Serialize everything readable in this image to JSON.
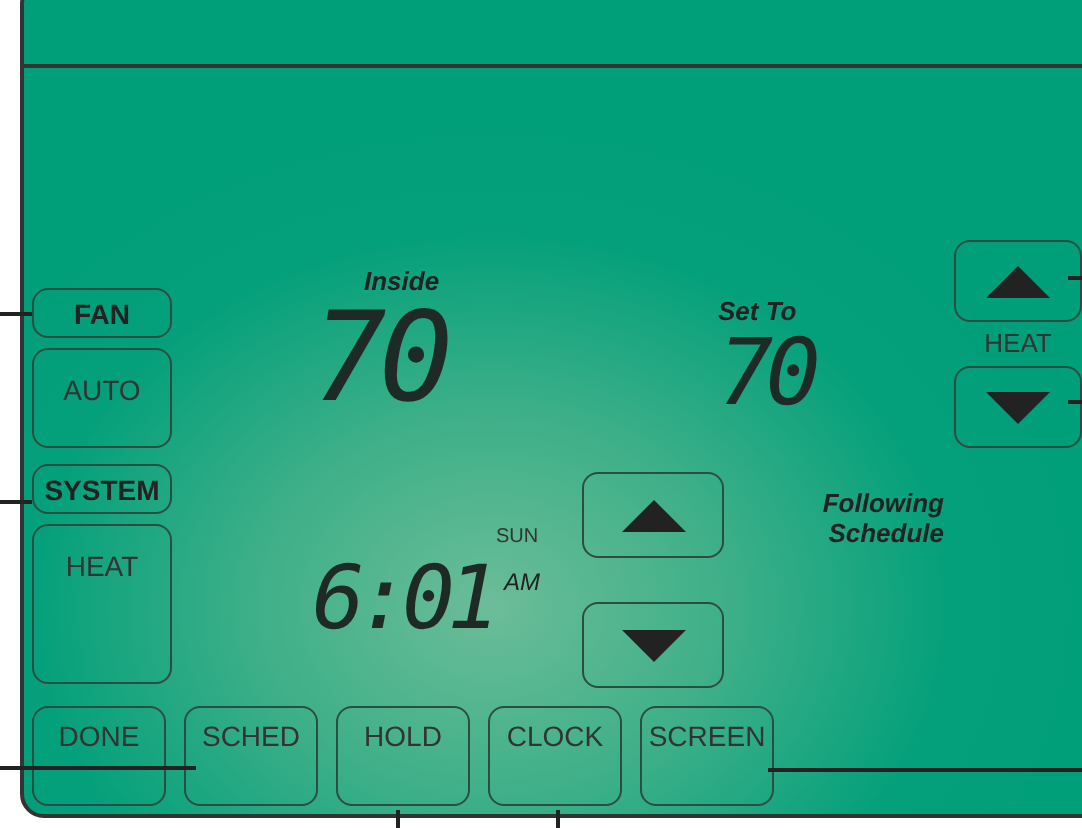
{
  "fan": {
    "label": "FAN",
    "mode": "AUTO"
  },
  "system": {
    "label": "SYSTEM",
    "mode": "HEAT"
  },
  "inside": {
    "label": "Inside",
    "temperature": "70"
  },
  "set_to": {
    "label": "Set To",
    "temperature": "70"
  },
  "heat_adjust": {
    "label": "HEAT"
  },
  "clock": {
    "day": "SUN",
    "time": "6:01",
    "meridiem": "AM"
  },
  "status": "Following Schedule",
  "buttons": [
    "DONE",
    "SCHED",
    "HOLD",
    "CLOCK",
    "SCREEN"
  ]
}
